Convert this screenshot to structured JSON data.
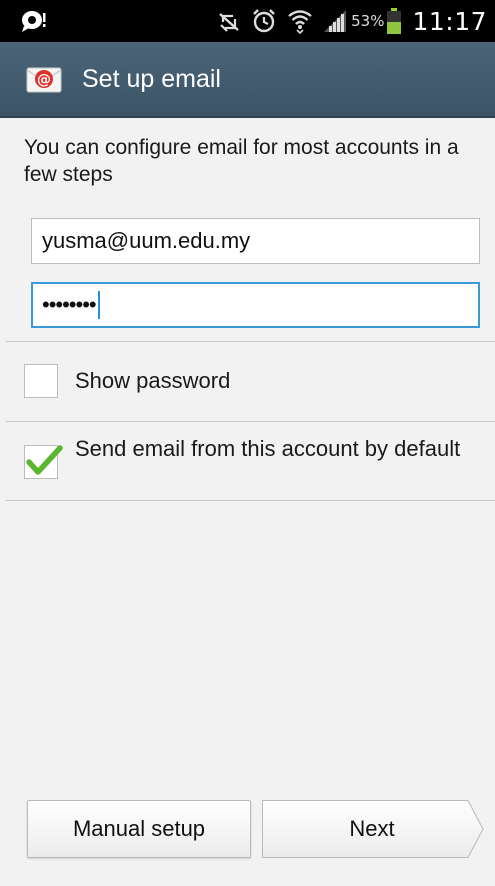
{
  "status_bar": {
    "left_icon": "chat-bubble-icon",
    "icons": [
      "mute-icon",
      "alarm-icon",
      "wifi-icon",
      "signal-icon"
    ],
    "battery_percent": "53%",
    "time": "11:17"
  },
  "action_bar": {
    "app_icon": "email-app-icon",
    "title": "Set up email"
  },
  "intro_text": "You can configure email for most accounts in a few steps",
  "form": {
    "email_value": "yusma@uum.edu.my",
    "password_masked": "••••••••"
  },
  "options": {
    "show_password": {
      "label": "Show password",
      "checked": false
    },
    "default_account": {
      "label": "Send email from this account by default",
      "checked": true
    }
  },
  "buttons": {
    "manual_setup": "Manual setup",
    "next": "Next"
  },
  "colors": {
    "action_bar": "#3f576a",
    "accent_focus": "#3a9ad9",
    "check_green": "#5bb52e"
  }
}
